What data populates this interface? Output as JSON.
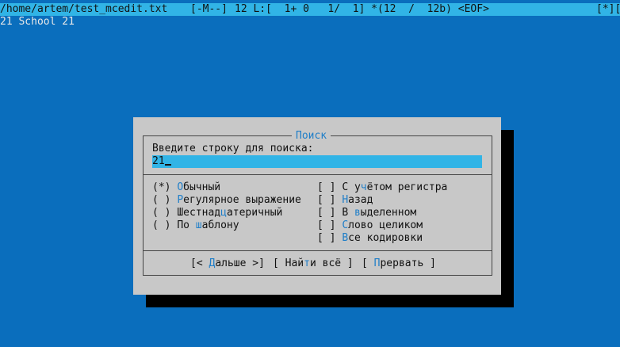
{
  "status_bar": {
    "file_path": "/home/artem/test_mcedit.txt",
    "mode": "[-M--]",
    "cursor_info": "12 L:[  1+ 0   1/  1] *(12  /  12b) <EOF>",
    "flags": "[*][X]"
  },
  "editor": {
    "line_1": "21 School 21"
  },
  "dialog": {
    "title": "Поиск",
    "prompt": "Введите строку для поиска:",
    "search_value": "21",
    "radios": [
      {
        "mark": "(*)",
        "hot": "О",
        "rest": "бычный"
      },
      {
        "mark": "( )",
        "hot": "Р",
        "rest": "егулярное выражение"
      },
      {
        "mark": "( )",
        "pre": "Шестнад",
        "hot": "ц",
        "rest": "атеричный"
      },
      {
        "mark": "( )",
        "pre": "По ",
        "hot": "ш",
        "rest": "аблону"
      }
    ],
    "checkboxes": [
      {
        "mark": "[ ]",
        "pre": "С у",
        "hot": "ч",
        "rest": "ётом регистра"
      },
      {
        "mark": "[ ]",
        "hot": "Н",
        "rest": "азад"
      },
      {
        "mark": "[ ]",
        "pre": "В ",
        "hot": "в",
        "rest": "ыделенном"
      },
      {
        "mark": "[ ]",
        "hot": "С",
        "rest": "лово целиком"
      },
      {
        "mark": "[ ]",
        "hot": "В",
        "rest": "се кодировки"
      }
    ],
    "buttons": {
      "next_open": "[< ",
      "next_hot": "Д",
      "next_rest": "альше >]",
      "all_open": "[ Най",
      "all_hot": "т",
      "all_rest": "и всё ]",
      "abort_open": "[ ",
      "abort_hot": "П",
      "abort_rest": "рервать ]"
    }
  }
}
